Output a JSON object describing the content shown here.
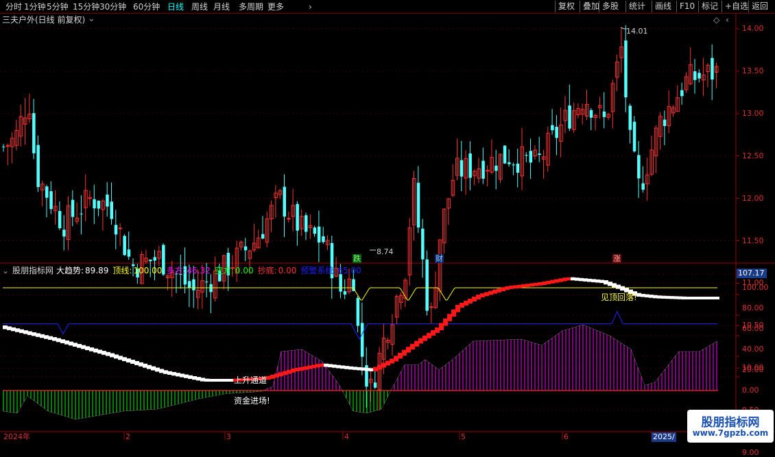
{
  "toolbar": {
    "periods": [
      "分时",
      "1分钟",
      "5分钟",
      "15分钟",
      "30分钟",
      "60分钟",
      "日线",
      "周线",
      "月线",
      "多周期",
      "更多"
    ],
    "active_period": "日线",
    "more_icon": "chevron-right-icon",
    "actions": [
      "复权",
      "叠加",
      "多股",
      "统计",
      "画线",
      "F10",
      "标记",
      "+自选",
      "返回"
    ]
  },
  "main_panel": {
    "stock_title": "三夫户外(日线 前复权)",
    "dropdown_icon": "chevron-down-circle-icon",
    "top_right_icons": [
      "diamond-icon",
      "chevron-left-icon"
    ],
    "price_axis": [
      "14.00",
      "13.50",
      "13.00",
      "12.50",
      "12.00",
      "11.50",
      "11.00",
      "10.50",
      "10.00",
      "9.50",
      "9.00"
    ],
    "high_label": "14.01",
    "low_label": "8.74",
    "markers": [
      {
        "text": "跌",
        "color": "#00c000"
      },
      {
        "text": "财",
        "color": "#1e64c8"
      },
      {
        "text": "涨",
        "color": "#c83232"
      }
    ]
  },
  "indicator_panel": {
    "name": "股朋指标网",
    "collapse_icon": "chevron-down-circle-icon",
    "values": [
      {
        "label": "大趋势:",
        "value": "89.89",
        "color": "#ffffff"
      },
      {
        "label": "顶线:",
        "value": "100.00",
        "color": "#ffff00"
      },
      {
        "label": "多方:",
        "value": "46.32",
        "color": "#ff00ff"
      },
      {
        "label": "空方:",
        "value": "0.00",
        "color": "#00ff00"
      },
      {
        "label": "抄底:",
        "value": "0.00",
        "color": "#ff3030"
      },
      {
        "label": "预警系统:",
        "value": "65.00",
        "color": "#2020ff"
      }
    ],
    "current_value": "107.17",
    "axis": [
      "100.00",
      "80.00",
      "60.00",
      "40.00",
      "20.00",
      "0.00"
    ],
    "annotations": [
      "上升通道",
      "资金进场!",
      "见顶回落!"
    ]
  },
  "time_axis": {
    "labels": [
      "2024年",
      "2",
      "3",
      "4",
      "5",
      "6"
    ],
    "current": "2025/"
  },
  "watermark": {
    "title": "股朋指标网",
    "url": "www.7gpzb.com"
  },
  "colors": {
    "up": "#ff3232",
    "down": "#54ffff",
    "bull": "#ff00ff",
    "bear": "#00ff00",
    "warn": "#2020ff",
    "top": "#ffff00"
  }
}
